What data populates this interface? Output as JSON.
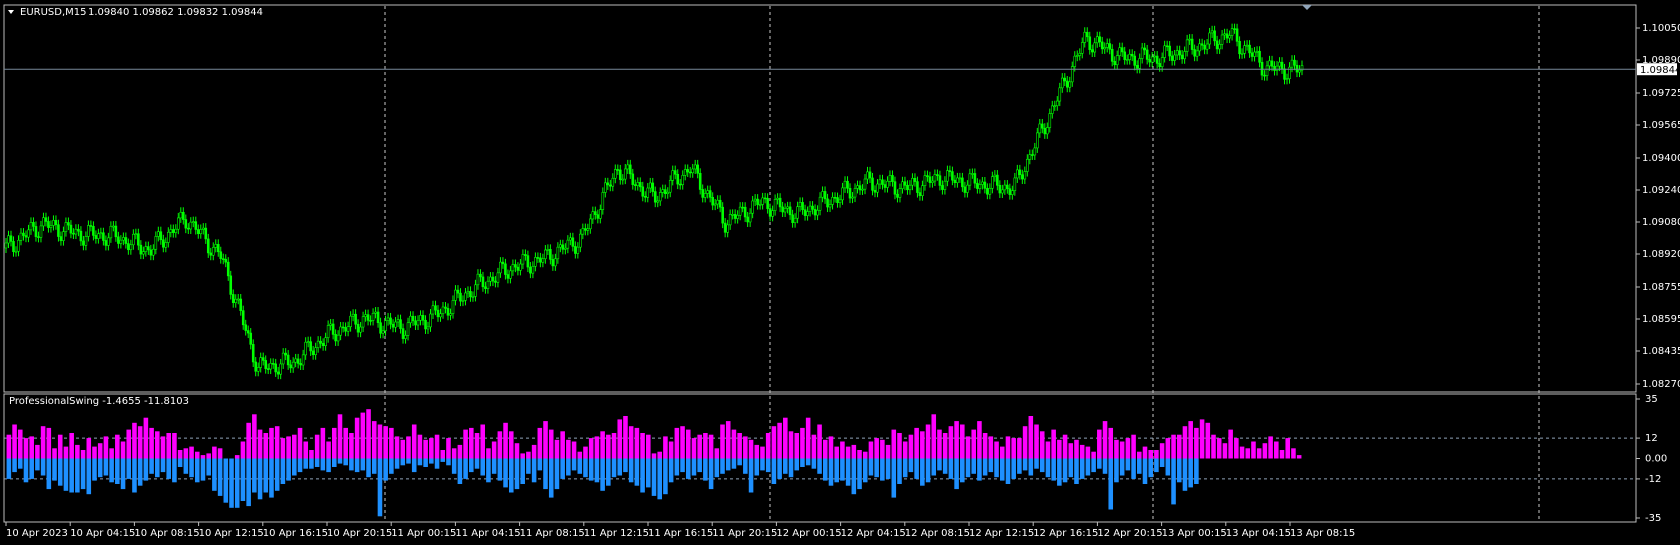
{
  "header": {
    "symbol": "EURUSD,M15",
    "ohlc": "1.09840 1.09862 1.09832 1.09844"
  },
  "colors": {
    "background": "#000000",
    "candle": "#00ff00",
    "positive_hist": "#ff00ff",
    "negative_hist": "#1e90ff",
    "grid": "#c8c8c8",
    "price_line": "#778899"
  },
  "chart_data": [
    {
      "type": "line",
      "name": "price",
      "y_axis_labels": [
        "1.10050",
        "1.09890",
        "1.09725",
        "1.09565",
        "1.09400",
        "1.09240",
        "1.09080",
        "1.08920",
        "1.08755",
        "1.08595",
        "1.08435",
        "1.08270"
      ],
      "ylim": [
        1.0825,
        1.1015
      ],
      "current_price": 1.09844,
      "current_price_label": "1.09844",
      "x": [
        "10 Apr 2023",
        "10 Apr 04:15",
        "10 Apr 08:15",
        "10 Apr 12:15",
        "10 Apr 16:15",
        "10 Apr 20:15",
        "11 Apr 00:15",
        "11 Apr 04:15",
        "11 Apr 08:15",
        "11 Apr 12:15",
        "11 Apr 16:15",
        "11 Apr 20:15",
        "12 Apr 00:15",
        "12 Apr 04:15",
        "12 Apr 08:15",
        "12 Apr 12:15",
        "12 Apr 16:15",
        "12 Apr 20:15",
        "13 Apr 00:15",
        "13 Apr 04:15",
        "13 Apr 08:15"
      ],
      "values": [
        1.0895,
        1.0907,
        1.0902,
        1.0901,
        1.0894,
        1.091,
        1.089,
        1.0835,
        1.0838,
        1.0852,
        1.086,
        1.0855,
        1.0862,
        1.0875,
        1.0885,
        1.089,
        1.09,
        1.0935,
        1.092,
        1.0935,
        1.0908,
        1.0918,
        1.0912,
        1.092,
        1.0928,
        1.0925,
        1.093,
        1.0927,
        1.0925,
        1.0962,
        1.1,
        1.099,
        1.099,
        1.0995,
        1.1002,
        1.0985,
        1.0984
      ]
    },
    {
      "type": "bar",
      "name": "ProfessionalSwing",
      "label": "ProfessionalSwing -1.4655 -11.8103",
      "y_axis_labels": [
        "35",
        "12",
        "0.00",
        "-12",
        "-35"
      ],
      "ylim": [
        -35,
        35
      ],
      "levels": [
        12,
        -12
      ],
      "values": [
        14,
        20,
        17,
        12,
        13,
        8,
        19,
        18,
        6,
        14,
        7,
        15,
        8,
        5,
        12,
        7,
        9,
        13,
        6,
        14,
        10,
        17,
        21,
        19,
        24,
        18,
        16,
        13,
        15,
        15,
        5,
        6,
        7,
        4,
        2,
        3,
        7,
        6,
        -2,
        -3,
        2,
        10,
        21,
        26,
        17,
        15,
        18,
        19,
        12,
        13,
        14,
        18,
        10,
        5,
        14,
        18,
        10,
        18,
        26,
        18,
        15,
        24,
        27,
        29,
        22,
        20,
        19,
        18,
        13,
        11,
        13,
        20,
        14,
        11,
        12,
        14,
        5,
        12,
        6,
        8,
        17,
        18,
        15,
        20,
        6,
        10,
        16,
        21,
        16,
        9,
        3,
        4,
        8,
        18,
        22,
        17,
        11,
        16,
        11,
        10,
        4,
        7,
        12,
        13,
        16,
        14,
        15,
        23,
        25,
        19,
        18,
        15,
        14,
        3,
        4,
        13,
        10,
        18,
        19,
        17,
        12,
        14,
        15,
        14,
        6,
        20,
        22,
        17,
        15,
        13,
        11,
        8,
        7,
        15,
        19,
        21,
        24,
        16,
        15,
        18,
        24,
        14,
        20,
        11,
        13,
        7,
        10,
        7,
        8,
        5,
        4,
        10,
        12,
        11,
        8,
        17,
        15,
        10,
        14,
        18,
        16,
        20,
        26,
        17,
        15,
        19,
        22,
        20,
        13,
        17,
        22,
        15,
        13,
        10,
        7,
        13,
        12,
        12,
        19,
        25,
        20,
        16,
        10,
        17,
        11,
        14,
        9,
        11,
        8,
        7,
        4,
        17,
        22,
        18,
        11,
        10,
        12,
        14,
        4,
        7,
        5,
        5,
        9,
        12,
        14,
        14,
        19,
        22,
        18,
        23,
        21,
        14,
        12,
        9,
        17,
        12,
        7,
        6,
        10,
        6,
        9,
        13,
        10,
        5,
        12,
        6,
        2
      ],
      "neg_values": [
        -12,
        -8,
        -6,
        -14,
        -12,
        -7,
        -10,
        -18,
        -13,
        -16,
        -19,
        -20,
        -20,
        -18,
        -21,
        -13,
        -11,
        -10,
        -14,
        -15,
        -18,
        -12,
        -20,
        -16,
        -13,
        -9,
        -11,
        -8,
        -12,
        -14,
        -5,
        -9,
        -11,
        -14,
        -13,
        -10,
        -19,
        -22,
        -26,
        -29,
        -29,
        -25,
        -28,
        -20,
        -24,
        -20,
        -23,
        -19,
        -15,
        -13,
        -10,
        -8,
        -6,
        -6,
        -5,
        -7,
        -8,
        -5,
        -3,
        -4,
        -7,
        -8,
        -7,
        -11,
        -9,
        -34,
        -13,
        -9,
        -6,
        -4,
        -3,
        -8,
        -4,
        -5,
        -3,
        -6,
        -2,
        -4,
        -9,
        -15,
        -12,
        -8,
        -6,
        -10,
        -14,
        -9,
        -13,
        -17,
        -20,
        -18,
        -15,
        -9,
        -14,
        -7,
        -18,
        -23,
        -18,
        -12,
        -10,
        -7,
        -9,
        -11,
        -13,
        -14,
        -19,
        -16,
        -11,
        -10,
        -8,
        -14,
        -16,
        -20,
        -17,
        -22,
        -24,
        -21,
        -14,
        -10,
        -8,
        -12,
        -10,
        -8,
        -13,
        -18,
        -11,
        -9,
        -7,
        -6,
        -4,
        -9,
        -20,
        -10,
        -7,
        -8,
        -15,
        -12,
        -9,
        -11,
        -7,
        -5,
        -4,
        -6,
        -9,
        -13,
        -16,
        -14,
        -13,
        -16,
        -21,
        -18,
        -14,
        -10,
        -11,
        -13,
        -12,
        -23,
        -15,
        -11,
        -8,
        -12,
        -16,
        -14,
        -10,
        -7,
        -9,
        -12,
        -18,
        -14,
        -11,
        -9,
        -13,
        -10,
        -8,
        -11,
        -13,
        -15,
        -12,
        -9,
        -7,
        -10,
        -6,
        -8,
        -11,
        -13,
        -16,
        -14,
        -11,
        -15,
        -12,
        -10,
        -8,
        -6,
        -9,
        -30,
        -14,
        -10,
        -7,
        -12,
        -9,
        -15,
        -11,
        -8,
        -5,
        -10,
        -27,
        -14,
        -19,
        -17,
        -15
      ]
    }
  ]
}
